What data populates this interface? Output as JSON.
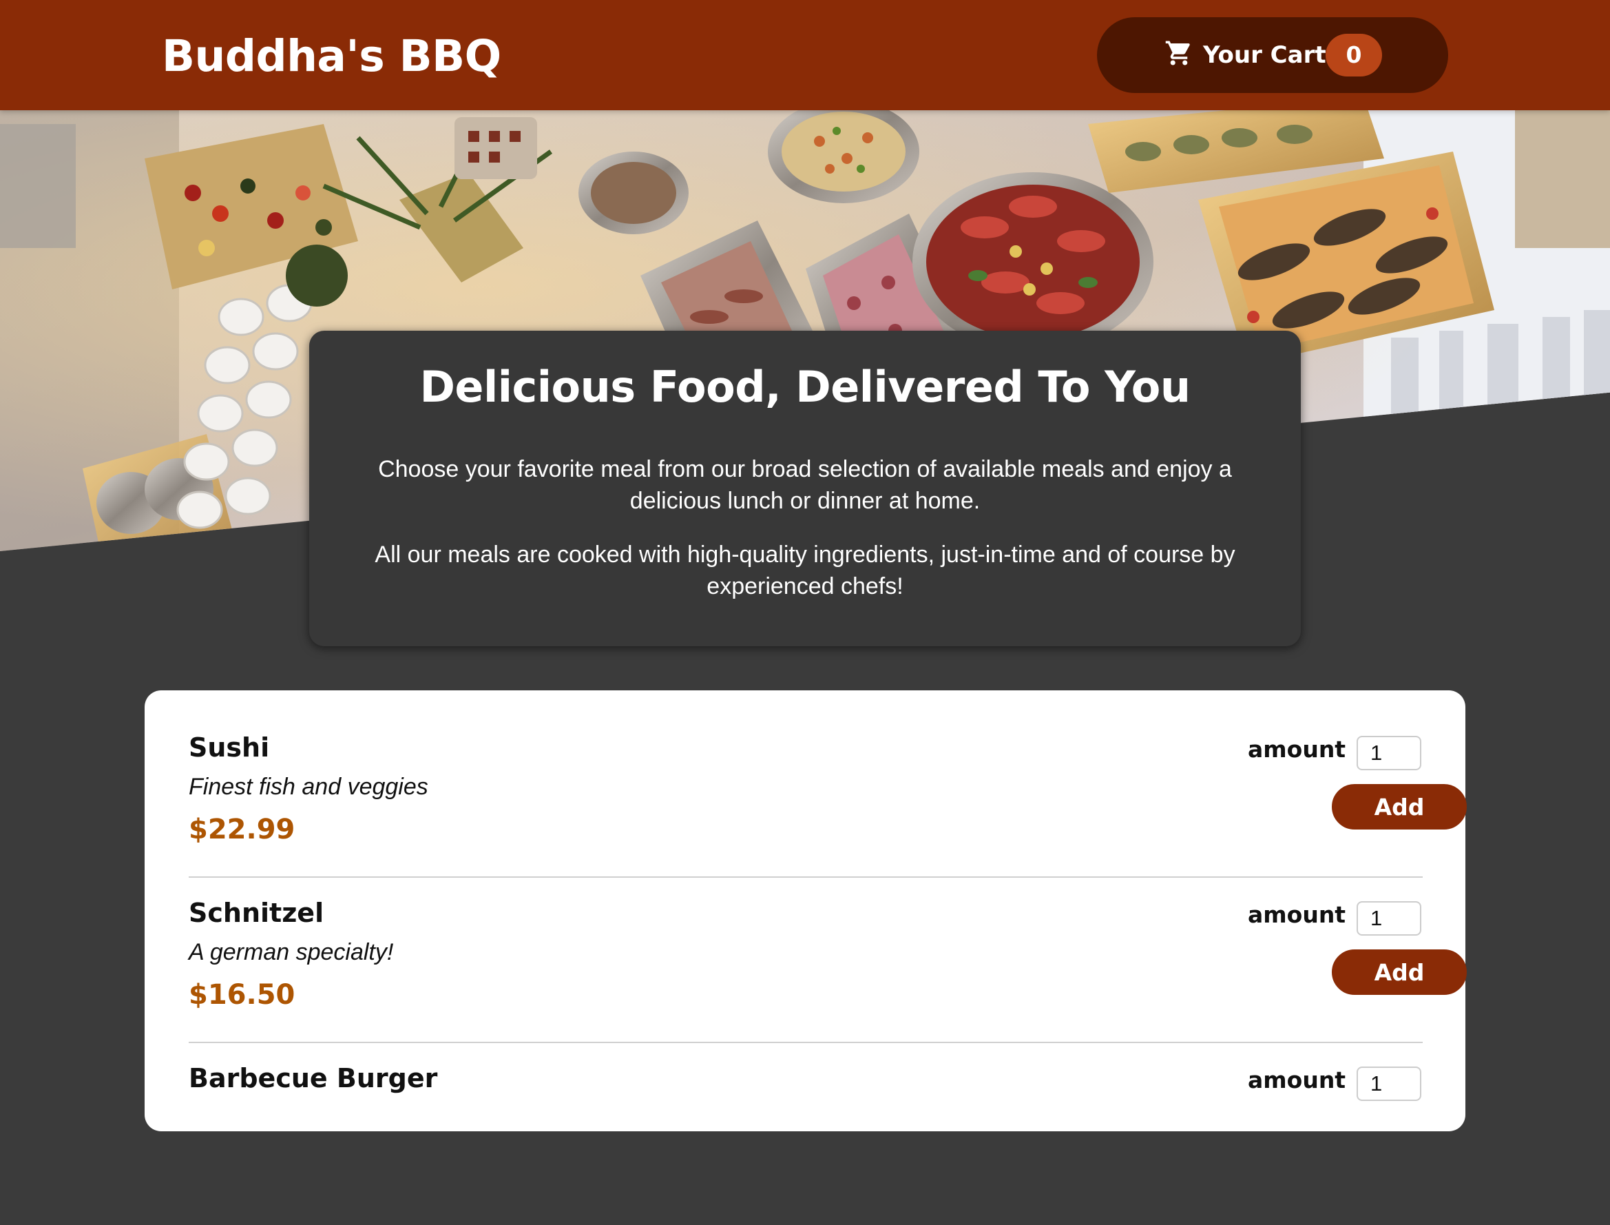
{
  "header": {
    "brand": "Buddha's BBQ",
    "cart": {
      "icon": "cart-icon",
      "label": "Your Cart",
      "count": "0"
    }
  },
  "summary": {
    "title": "Delicious Food, Delivered To You",
    "paragraph1": "Choose your favorite meal from our broad selection of available meals and enjoy a delicious lunch or dinner at home.",
    "paragraph2": "All our meals are cooked with high-quality ingredients, just-in-time and of course by experienced chefs!"
  },
  "meals": [
    {
      "name": "Sushi",
      "description": "Finest fish and veggies",
      "price": "$22.99",
      "amount_label": "amount",
      "amount_value": "1",
      "add_label": "Add"
    },
    {
      "name": "Schnitzel",
      "description": "A german specialty!",
      "price": "$16.50",
      "amount_label": "amount",
      "amount_value": "1",
      "add_label": "Add"
    },
    {
      "name": "Barbecue Burger",
      "amount_label": "amount",
      "amount_value": "1"
    }
  ],
  "colors": {
    "header_bg": "#8a2b06",
    "cart_bg": "#4d1601",
    "badge_bg": "#b94517",
    "page_bg": "#3b3b3b",
    "price": "#ad5502"
  }
}
